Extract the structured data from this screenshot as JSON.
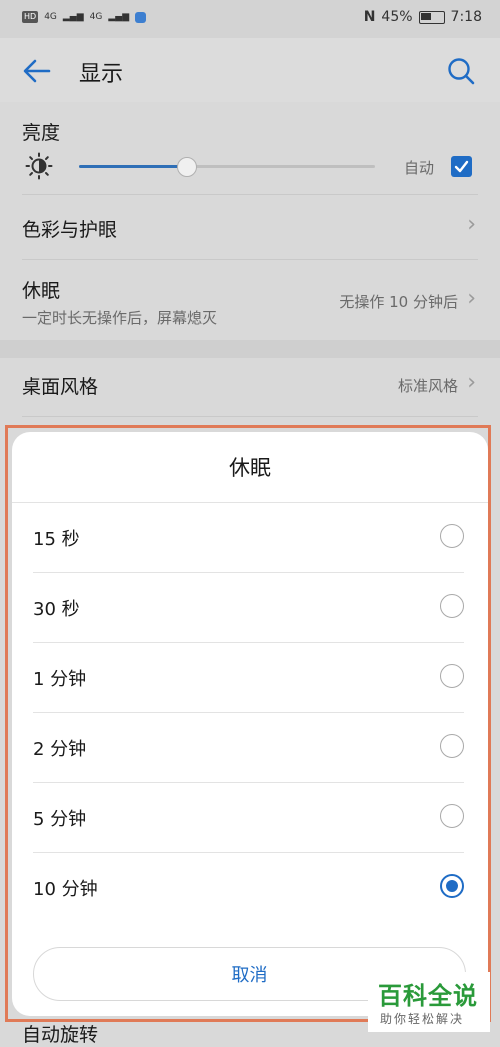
{
  "status_bar": {
    "hd": "HD",
    "network1": "4G",
    "network2": "4G",
    "battery": "45%",
    "time": "7:18"
  },
  "header": {
    "title": "显示"
  },
  "settings": {
    "brightness": {
      "label": "亮度",
      "level_percent": 36,
      "auto_label": "自动",
      "auto_checked": true
    },
    "color": {
      "label": "色彩与护眼"
    },
    "sleep": {
      "label": "休眠",
      "subtitle": "一定时长无操作后，屏幕熄灭",
      "value": "无操作 10 分钟后"
    },
    "desktop": {
      "label": "桌面风格",
      "value": "标准风格"
    },
    "auto_rotate": {
      "label": "自动旋转"
    }
  },
  "dialog": {
    "title": "休眠",
    "options": [
      {
        "label": "15 秒",
        "selected": false
      },
      {
        "label": "30 秒",
        "selected": false
      },
      {
        "label": "1 分钟",
        "selected": false
      },
      {
        "label": "2 分钟",
        "selected": false
      },
      {
        "label": "5 分钟",
        "selected": false
      },
      {
        "label": "10 分钟",
        "selected": true
      }
    ],
    "cancel_label": "取消"
  },
  "watermark": {
    "logo": "百科全说",
    "sub": "助你轻松解决"
  },
  "colors": {
    "accent": "#1f6cc5",
    "highlight_border": "#e07a57",
    "watermark_green": "#2a9a3a"
  }
}
